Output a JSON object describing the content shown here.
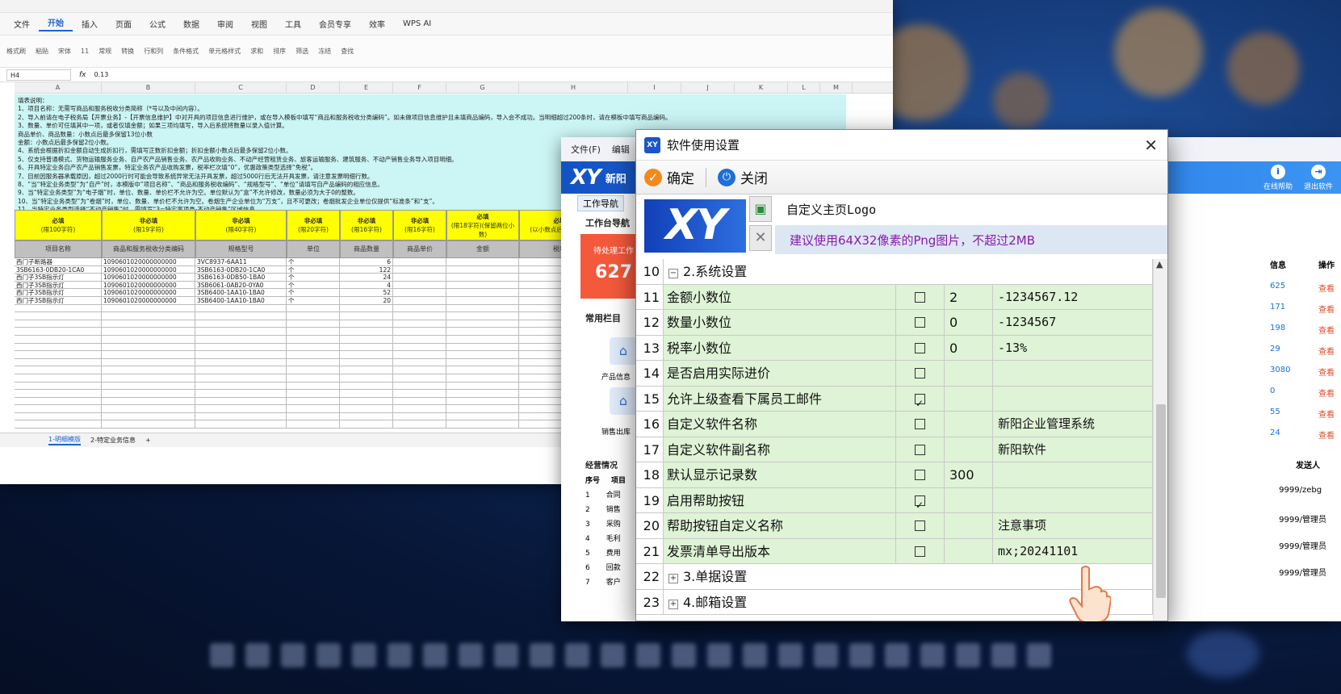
{
  "spreadsheet": {
    "menu": [
      "文件",
      "开始",
      "插入",
      "页面",
      "公式",
      "数据",
      "审阅",
      "视图",
      "工具",
      "会员专享",
      "效率",
      "WPS AI"
    ],
    "active_menu": "开始",
    "ribbon": [
      "格式刷",
      "粘贴",
      "宋体",
      "11",
      "常规",
      "转换",
      "行和列",
      "条件格式",
      "单元格样式",
      "求和",
      "排序",
      "筛选",
      "冻结",
      "查找"
    ],
    "cell_ref": "H4",
    "formula": "0.13",
    "columns": [
      "A",
      "B",
      "C",
      "D",
      "E",
      "F",
      "G",
      "H",
      "I",
      "J",
      "K",
      "L",
      "M"
    ],
    "notes": [
      "填表说明：",
      "1、项目名称：无需写商品和服务税收分类简称（*号以及中间内容）。",
      "2、导入前请在电子税务局【开票业务】-【开票信息维护】中对开具的项目信息进行维护，或在导入模板中填写“商品和服务税收分类编码”。如未做项目信息维护且未填商品编码，导入会不成功。当明细超过200条时，请在模板中填写商品编码。",
      "3、数量、单价可任填其中一项，或者仅填金额；如果三项均填写，导入后系统将数量以录入值计算。",
      "商品单价、商品数量：小数点后最多保留13位小数",
      "金额：小数点后最多保留2位小数。",
      "4、系统会根据折扣金额自动生成折扣行，需填写正数折扣金额；折扣金额小数点后最多保留2位小数。",
      "5、仅支持普通模式、货物运输服务业务、自产农产品销售业务、农产品收购业务、不动产经营租赁业务、旅客运输服务、建筑服务、不动产销售业务导入项目明细。",
      "6、开具特定业务自产农产品销售发票，特定业务农产品收购发票，税率栏次填“0”，优惠政策类型选择“免税”。",
      "7、目前因服务器承载原因，超过2000行时可能会导致系统异常无法开具发票，超过5000行后无法开具发票，请注意发票明细行数。",
      "8、“当“特定业务类型”为“自产”时，本模版中“项目名称”、“商品和服务税收编码”、“规格型号”、“单位”请填写自产品编码的相应信息。",
      "9、当“特定业务类型”为“电子烟”时，单位、数量、单价栏不允许为空。单位默认为“盒”不允许修改，数量必须为大于0的整数。",
      "10、当“特定业务类型”为“卷烟”时，单位、数量、单价栏不允许为空。卷烟生产企业单位为“万支”，且不可更改；卷烟批发企业单位仅提供“标准条”和“支”。",
      "11、当特定业务类型选择“不动产销售”时，需填写“3=特定事项类-不动产销售”区域信息。"
    ],
    "header_required": [
      {
        "l1": "必填",
        "l2": "(限100字符)"
      },
      {
        "l1": "非必填",
        "l2": "(限19字符)"
      },
      {
        "l1": "非必填",
        "l2": "(限40字符)"
      },
      {
        "l1": "非必填",
        "l2": "(限20字符)"
      },
      {
        "l1": "非必填",
        "l2": "(限16字符)"
      },
      {
        "l1": "非必填",
        "l2": "(限16字符)"
      },
      {
        "l1": "必填",
        "l2": "(限18字符)(保留两位小数)"
      },
      {
        "l1": "必填",
        "l2": "(以小数点后两位表示)"
      }
    ],
    "header_names": [
      "项目名称",
      "商品和服务税收分类编码",
      "规格型号",
      "单位",
      "商品数量",
      "商品单价",
      "金额",
      "税率"
    ],
    "rows": [
      [
        "西门子断路器",
        "1090601020000000000",
        "3VC8937-6AA11",
        "个",
        "6",
        "",
        "",
        ""
      ],
      [
        "3SB6163-0DB20-1CA0",
        "1090601020000000000",
        "3SB6163-0DB20-1CA0",
        "个",
        "122",
        "",
        "",
        ""
      ],
      [
        "西门子3SB指示灯",
        "1090601020000000000",
        "3SB6163-0DB50-1BA0",
        "个",
        "24",
        "",
        "",
        ""
      ],
      [
        "西门子3SB指示灯",
        "1090601020000000000",
        "3SB6061-0AB20-0YA0",
        "个",
        "4",
        "",
        "",
        ""
      ],
      [
        "西门子3SB指示灯",
        "1090601020000000000",
        "3SB6400-1AA10-1BA0",
        "个",
        "52",
        "",
        "",
        ""
      ],
      [
        "西门子3SB指示灯",
        "1090601020000000000",
        "3SB6400-1AA10-1BA0",
        "个",
        "20",
        "",
        "",
        ""
      ]
    ],
    "sheet_tabs": [
      "1-明细模版",
      "2-特定业务信息"
    ],
    "active_tab": "1-明细模版"
  },
  "app": {
    "menu": [
      "文件(F)",
      "编辑"
    ],
    "brand_logo": "XY",
    "brand_name": "新阳",
    "tools": [
      {
        "icon": "i",
        "label": "在线帮助"
      },
      {
        "icon": "⇥",
        "label": "退出软件"
      }
    ],
    "nav_tab": "工作导航",
    "workbench": "工作台导航",
    "pending_label": "待处理工作",
    "pending_count": "627",
    "common_label": "常用栏目",
    "product_label": "产品信息",
    "sales_label": "销售出库",
    "ops_label": "经营情况",
    "ops_header": [
      "序号",
      "项目"
    ],
    "ops_rows": [
      [
        "1",
        "合同"
      ],
      [
        "2",
        "销售"
      ],
      [
        "3",
        "采购"
      ],
      [
        "4",
        "毛利"
      ],
      [
        "5",
        "费用"
      ],
      [
        "6",
        "回款"
      ],
      [
        "7",
        "客户"
      ]
    ],
    "right_headers": [
      "信息",
      "操作"
    ],
    "right_rows": [
      {
        "v": "625",
        "op": "查看"
      },
      {
        "v": "171",
        "op": "查看"
      },
      {
        "v": "198",
        "op": "查看"
      },
      {
        "v": "29",
        "op": "查看"
      },
      {
        "v": "3080",
        "op": "查看"
      },
      {
        "v": "0",
        "op": "查看"
      },
      {
        "v": "55",
        "op": "查看"
      },
      {
        "v": "24",
        "op": "查看"
      }
    ],
    "sender_header": "发送人",
    "senders": [
      "9999/zebg",
      "9999/管理员",
      "9999/管理员",
      "9999/管理员"
    ]
  },
  "dialog": {
    "title": "软件使用设置",
    "app_icon": "XY",
    "ok_label": "确定",
    "close_label": "关闭",
    "logo_text": "XY",
    "logo_label": "自定义主页Logo",
    "logo_hint": "建议使用64X32像素的Png图片，不超过2MB",
    "rows": [
      {
        "num": "10",
        "group": true,
        "toggle": "−",
        "name": "2.系统设置"
      },
      {
        "num": "11",
        "name": "金额小数位",
        "checked": false,
        "value": "2",
        "example": "-1234567.12"
      },
      {
        "num": "12",
        "name": "数量小数位",
        "checked": false,
        "value": "0",
        "example": "-1234567"
      },
      {
        "num": "13",
        "name": "税率小数位",
        "checked": false,
        "value": "0",
        "example": "-13%"
      },
      {
        "num": "14",
        "name": "是否启用实际进价",
        "checked": false,
        "value": "",
        "example": ""
      },
      {
        "num": "15",
        "name": "允许上级查看下属员工邮件",
        "checked": true,
        "value": "",
        "example": ""
      },
      {
        "num": "16",
        "name": "自定义软件名称",
        "checked": false,
        "value": "",
        "example": "新阳企业管理系统"
      },
      {
        "num": "17",
        "name": "自定义软件副名称",
        "checked": false,
        "value": "",
        "example": "新阳软件"
      },
      {
        "num": "18",
        "name": "默认显示记录数",
        "checked": false,
        "value": "300",
        "example": ""
      },
      {
        "num": "19",
        "name": "启用帮助按钮",
        "checked": true,
        "value": "",
        "example": ""
      },
      {
        "num": "20",
        "name": "帮助按钮自定义名称",
        "checked": false,
        "value": "",
        "example": "注意事项"
      },
      {
        "num": "21",
        "name": "发票清单导出版本",
        "checked": false,
        "value": "",
        "example": "mx;20241101"
      },
      {
        "num": "22",
        "group": true,
        "toggle": "+",
        "name": "3.单据设置"
      },
      {
        "num": "23",
        "group": true,
        "toggle": "+",
        "name": "4.邮箱设置"
      }
    ]
  },
  "colors": {
    "accent": "#1a64d2",
    "green_row": "#dff3d6",
    "hint_text": "#8a1ab0",
    "pending": "#f4593b"
  }
}
